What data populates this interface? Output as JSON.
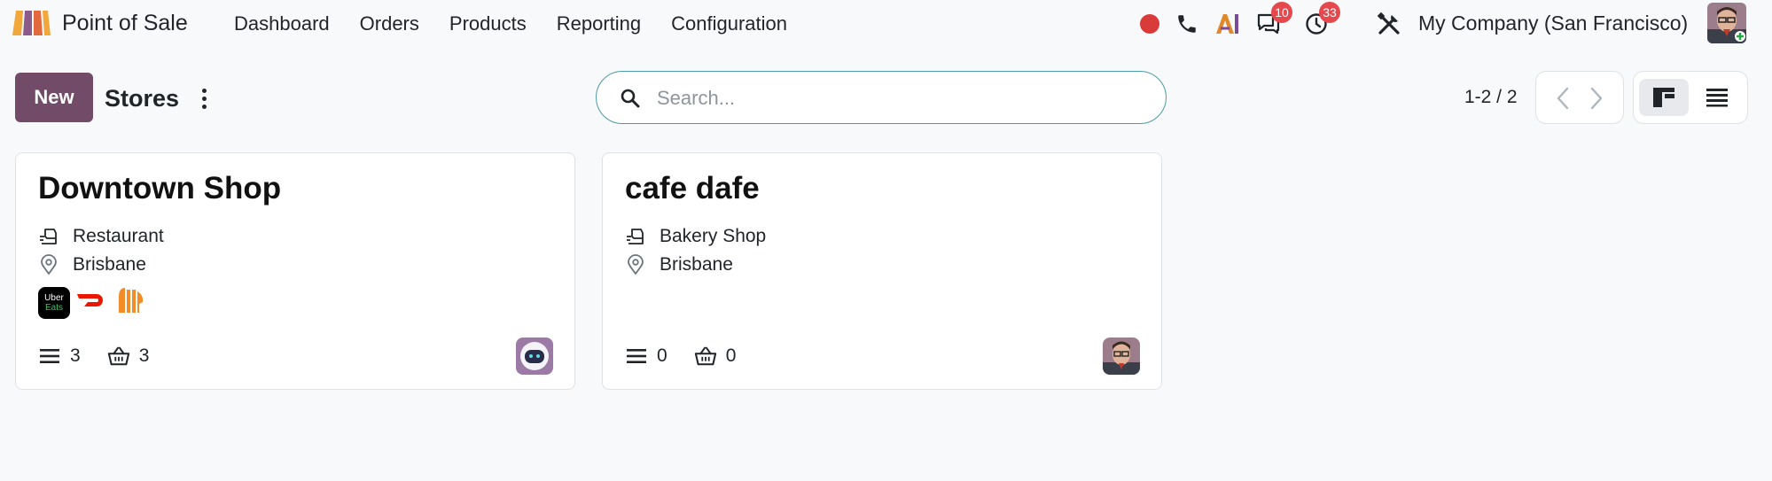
{
  "navbar": {
    "app_name": "Point of Sale",
    "menu": [
      "Dashboard",
      "Orders",
      "Products",
      "Reporting",
      "Configuration"
    ],
    "company": "My Company (San Francisco)",
    "messages_count": "10",
    "activities_count": "33"
  },
  "control_panel": {
    "new_label": "New",
    "title": "Stores",
    "search_placeholder": "Search...",
    "pager": "1-2 / 2"
  },
  "cards": [
    {
      "title": "Downtown Shop",
      "type": "Restaurant",
      "location": "Brisbane",
      "delivery_services": [
        "uber-eats",
        "doordash",
        "menulog"
      ],
      "uber_label_1": "Uber",
      "uber_label_2": "Eats",
      "count_list": "3",
      "count_basket": "3"
    },
    {
      "title": "cafe dafe",
      "type": "Bakery Shop",
      "location": "Brisbane",
      "count_list": "0",
      "count_basket": "0"
    }
  ],
  "colors": {
    "brand": "#714b67",
    "badge": "#e5484d",
    "search_border": "#4e9aa5",
    "record_dot": "#d93a3a"
  }
}
